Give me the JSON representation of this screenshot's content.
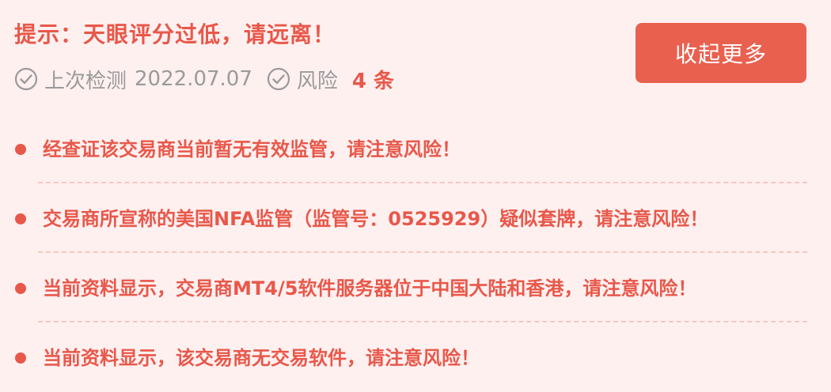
{
  "header": {
    "title": "提示：天眼评分过低，请远离！",
    "last_check_label": "上次检测",
    "last_check_date": "2022.07.07",
    "risk_label": "风险",
    "risk_count": "4 条",
    "collapse_label": "收起更多"
  },
  "colors": {
    "accent": "#e8584a",
    "background": "#fff0f0",
    "meta_text": "#9a9a9a"
  },
  "icons": {
    "check": "check-circle-icon",
    "bullet": "bullet-dot-icon"
  },
  "risks": [
    {
      "text": "经查证该交易商当前暂无有效监管，请注意风险！"
    },
    {
      "text": "交易商所宣称的美国NFA监管（监管号：0525929）疑似套牌，请注意风险！"
    },
    {
      "text": "当前资料显示，交易商MT4/5软件服务器位于中国大陆和香港，请注意风险！"
    },
    {
      "text": "当前资料显示，该交易商无交易软件，请注意风险！"
    }
  ]
}
